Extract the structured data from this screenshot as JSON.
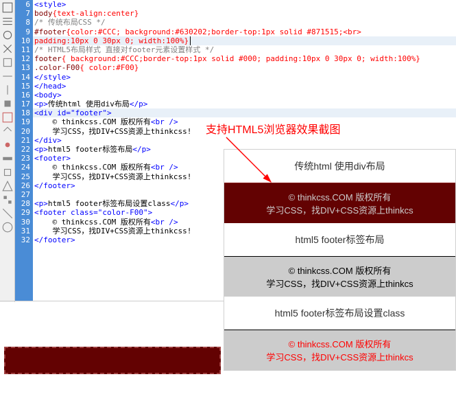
{
  "annotation": "支持HTML5浏览器效果截图",
  "line_numbers": [
    "6",
    "7",
    "8",
    "9",
    "10",
    "11",
    "12",
    "13",
    "14",
    "15",
    "16",
    "17",
    "18",
    "19",
    "20",
    "21",
    "22",
    "23",
    "24",
    "25",
    "26",
    "27",
    "28",
    "29",
    "30",
    "31",
    "32"
  ],
  "code": {
    "l6": "<style>",
    "l7_sel": "body",
    "l7_rule": "{text-align:center}",
    "l8": "/* 传统布局CSS */",
    "l9_sel": "#footer",
    "l9_rule": "{color:#CCC; background:#630202;border-top:1px solid #871515;<br>",
    "l10": " padding:10px 0 30px 0; width:100%}",
    "l11": "/* HTML5布局样式 直接对footer元素设置样式 */",
    "l12_sel": "footer",
    "l12_rule": "{ background:#CCC;border-top:1px solid #000; padding:10px 0 30px 0; width:100%}",
    "l13_sel": ".color-F00",
    "l13_rule": "{ color:#F00}",
    "l14": "</style>",
    "l15": "</head>",
    "l16": "<body>",
    "l17_open": "<p>",
    "l17_txt": "传统html 使用div布局",
    "l17_close": "</p>",
    "l18": "<div id=\"footer\">",
    "l19_txt": "© thinkcss.COM 版权所有",
    "l19_tag": "<br />",
    "l20_txt": "学习CSS，找DIV+CSS资源上thinkcss!",
    "l21": "</div>",
    "l22_open": "<p>",
    "l22_txt": "html5 footer标签布局",
    "l22_close": "</p>",
    "l23": "<footer>",
    "l24_txt": "© thinkcss.COM 版权所有",
    "l24_tag": "<br />",
    "l25_txt": "学习CSS，找DIV+CSS资源上thinkcss!",
    "l26": "</footer>",
    "l28_open": "<p>",
    "l28_txt": "html5 footer标签布局设置class",
    "l28_close": "</p>",
    "l29": "<footer class=\"color-F00\">",
    "l30_txt": "© thinkcss.COM 版权所有",
    "l30_tag": "<br />",
    "l31_txt": "学习CSS，找DIV+CSS资源上thinkcss!",
    "l32": "</footer>"
  },
  "preview": {
    "row1": "传统html 使用div布局",
    "footer1_l1": "© thinkcss.COM 版权所有",
    "footer1_l2": "学习CSS，找DIV+CSS资源上thinkcs",
    "row2": "html5 footer标签布局",
    "footer2_l1": "© thinkcss.COM 版权所有",
    "footer2_l2": "学习CSS，找DIV+CSS资源上thinkcs",
    "row3": "html5 footer标签布局设置class",
    "footer3_l1": "© thinkcss.COM 版权所有",
    "footer3_l2": "学习CSS，找DIV+CSS资源上thinkcs"
  }
}
